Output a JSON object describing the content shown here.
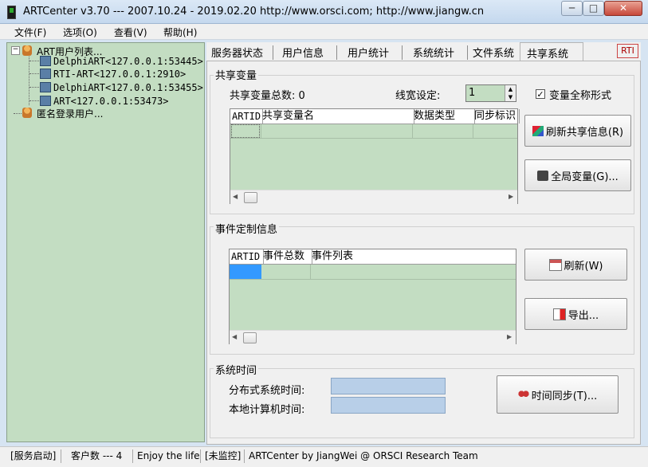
{
  "window": {
    "title": "ARTCenter v3.70 ---  2007.10.24 - 2019.02.20  http://www.orsci.com; http://www.jiangw.cn",
    "min_label": "─",
    "max_label": "□",
    "close_label": "✕"
  },
  "menu": [
    "文件(F)",
    "选项(O)",
    "查看(V)",
    "帮助(H)"
  ],
  "tree": {
    "root_label": "ART用户列表...",
    "expander": "−",
    "children": [
      "DelphiART<127.0.0.1:53445>",
      "RTI-ART<127.0.0.1:2910>",
      "DelphiART<127.0.0.1:53455>",
      "ART<127.0.0.1:53473>"
    ],
    "anon_label": "匿名登录用户..."
  },
  "tabs": [
    "服务器状态",
    "用户信息",
    "用户统计",
    "系统统计",
    "文件系统",
    "共享系统"
  ],
  "active_tab": "共享系统",
  "rti_label": "RTI",
  "shared": {
    "group_title": "共享变量",
    "total_label": "共享变量总数: 0",
    "linewidth_label": "线宽设定:",
    "linewidth_value": "1",
    "fullname_label": "变量全称形式",
    "fullname_checked": true,
    "columns": [
      "ARTID",
      "共享变量名",
      "数据类型",
      "同步标识"
    ],
    "refresh_button": "刷新共享信息(R)",
    "global_button": "全局变量(G)..."
  },
  "events": {
    "group_title": "事件定制信息",
    "columns": [
      "ARTID",
      "事件总数",
      "事件列表"
    ],
    "refresh_button": "刷新(W)",
    "export_button": "导出..."
  },
  "systime": {
    "group_title": "系统时间",
    "distributed_label": "分布式系统时间:",
    "local_label": "本地计算机时间:",
    "sync_button": "时间同步(T)..."
  },
  "status": {
    "service": "[服务启动]",
    "clients": "客户数 --- 4",
    "motto": "Enjoy the life",
    "monitor": "[未监控]",
    "credit": "ARTCenter by JiangWei @ ORSCI Research Team"
  },
  "colors": {
    "tree_bg": "#c3ddc2",
    "grid_bg": "#c3ddc2",
    "selection": "#3399ff",
    "time_field": "#b8cfe8"
  }
}
